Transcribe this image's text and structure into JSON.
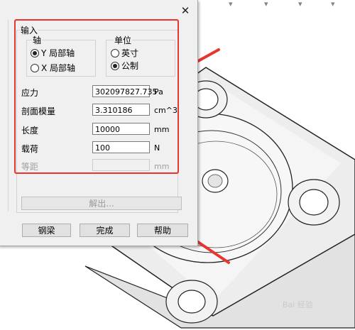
{
  "dialog": {
    "close_icon": "✕",
    "input_group_title": "输入",
    "axis_group_title": "轴",
    "axis_options": [
      {
        "label": "Y 局部轴",
        "selected": true
      },
      {
        "label": "X 局部轴",
        "selected": false
      }
    ],
    "unit_group_title": "单位",
    "unit_options": [
      {
        "label": "英寸",
        "selected": false
      },
      {
        "label": "公制",
        "selected": true
      }
    ],
    "fields": [
      {
        "label": "应力",
        "value": "302097827.735",
        "unit": "Pa"
      },
      {
        "label": "剖面模量",
        "value": "3.310186",
        "unit": "cm^3"
      },
      {
        "label": "长度",
        "value": "10000",
        "unit": "mm"
      },
      {
        "label": "载荷",
        "value": "100",
        "unit": "N"
      },
      {
        "label": "等距",
        "value": "",
        "unit": "mm",
        "disabled": true
      }
    ],
    "solve_button": "解出...",
    "buttons": {
      "beam": "钢梁",
      "done": "完成",
      "help": "帮助"
    }
  },
  "colors": {
    "highlight_frame": "#e8352f",
    "arrow": "#e8352f"
  },
  "watermark": "Bai 经验"
}
